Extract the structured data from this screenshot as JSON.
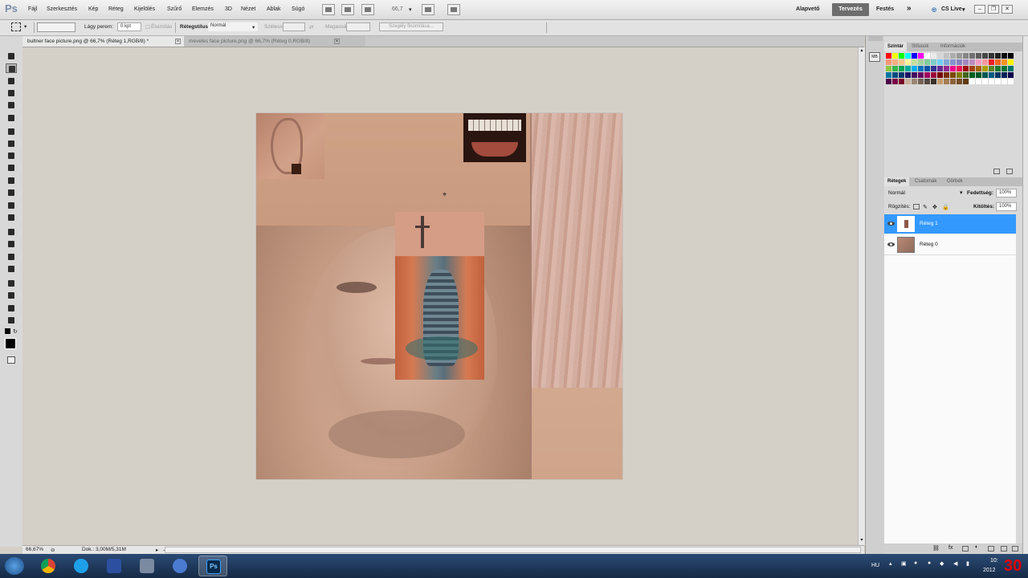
{
  "app": {
    "logo": "Ps"
  },
  "menu": [
    "Fájl",
    "Szerkesztés",
    "Kép",
    "Réteg",
    "Kijelölés",
    "Szűrő",
    "Elemzés",
    "3D",
    "Nézet",
    "Ablak",
    "Súgó"
  ],
  "zoom_label": "66,7",
  "workspaces": {
    "basic": "Alapvető",
    "design": "Tervezés",
    "painting": "Festés",
    "more": "»",
    "cslive": "CS Live"
  },
  "options": {
    "feather_label": "Lágy perem:",
    "feather_value": "0 kpt",
    "antialias_label": "Élsimítás",
    "style_label": "Rétegstílus:",
    "style_value": "Normál",
    "width_label": "Szélesség:",
    "height_label": "Magasság:",
    "refine_button": "Szegély finomítása..."
  },
  "tabs": [
    {
      "label": "bultner face picture.png @ 66,7% (Réteg 1,RGB/8) *",
      "close": "×"
    },
    {
      "label": "meveles face picture.png @ 66,7% (Réteg 0,RGB/8)",
      "close": "×"
    }
  ],
  "status": {
    "zoom": "66,67%",
    "doc": "Dok.: 3,00M/5,31M"
  },
  "swatches_panel": {
    "tabs": [
      "Színtár",
      "Stílusok",
      "Információk"
    ]
  },
  "layers_panel": {
    "tabs": [
      "Rétegek",
      "Csatornák",
      "Görbék"
    ],
    "blend_mode": "Normál",
    "opacity_label": "Fedettség:",
    "opacity_value": "100%",
    "lock_label": "Rögzítés:",
    "fill_label": "Kitöltés:",
    "fill_value": "100%",
    "layers": [
      {
        "name": "Réteg 1",
        "selected": true
      },
      {
        "name": "Réteg 0",
        "selected": false
      }
    ]
  },
  "taskbar": {
    "lang": "HU",
    "time": "10: ",
    "year": "2012",
    "badge": "30",
    "active_app": "photoshop"
  },
  "colors": {
    "selection_blue": "#3399ff",
    "active_workspace": "#6d6d6d"
  }
}
